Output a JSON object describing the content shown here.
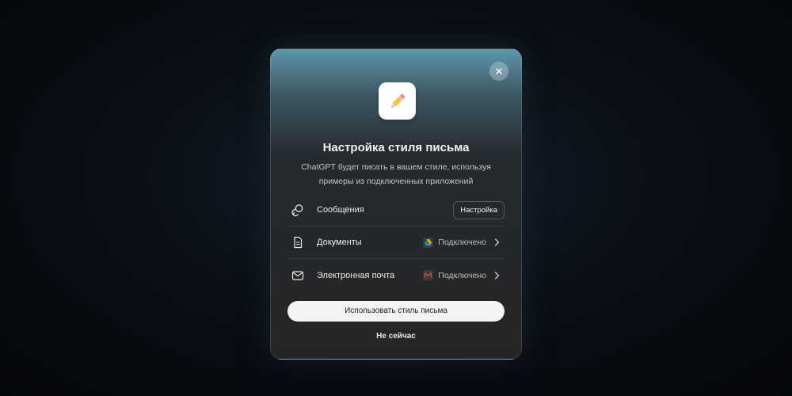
{
  "dialog": {
    "title": "Настройка стиля письма",
    "subtitle": "ChatGPT будет писать в вашем стиле, используя примеры из подключенных приложений",
    "app_icon": "pencil-icon",
    "close_icon": "close-icon"
  },
  "sources": [
    {
      "label": "Сообщения",
      "icon": "messages-icon",
      "action": "Настройка"
    },
    {
      "label": "Документы",
      "icon": "document-icon",
      "status": "Подключено",
      "brand": "google-drive-icon"
    },
    {
      "label": "Электронная почта",
      "icon": "mail-icon",
      "status": "Подключено",
      "brand": "gmail-icon"
    }
  ],
  "actions": {
    "primary": "Использовать стиль письма",
    "secondary": "Не сейчас"
  },
  "colors": {
    "accent_top": "#5e97ad",
    "panel": "#242526",
    "primary_button": "#f4f4f4"
  }
}
